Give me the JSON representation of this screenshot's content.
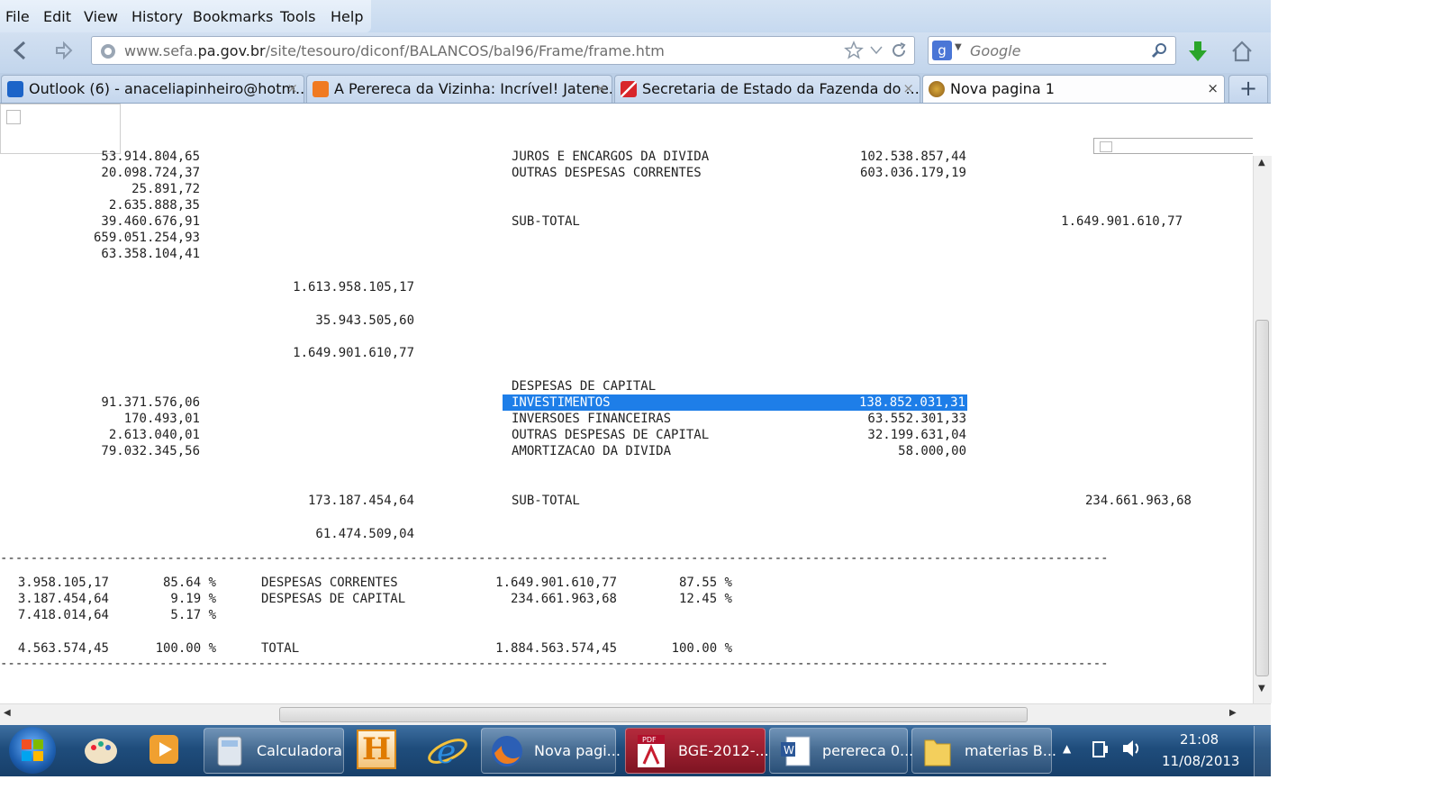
{
  "menu": [
    "File",
    "Edit",
    "View",
    "History",
    "Bookmarks",
    "Tools",
    "Help"
  ],
  "url": {
    "prefix": "www.sefa.",
    "domain": "pa.gov.br",
    "path": "/site/tesouro/diconf/BALANCOS/bal96/Frame/frame.htm"
  },
  "search": {
    "placeholder": "Google"
  },
  "tabs": [
    {
      "label": "Outlook (6) - anaceliapinheiro@hotm...",
      "icon": "outlook-icon"
    },
    {
      "label": "A Perereca da Vizinha: Incrível! Jatene...",
      "icon": "blogger-icon"
    },
    {
      "label": "Secretaria de Estado da Fazenda do ...",
      "icon": "para-flag-icon"
    },
    {
      "label": "Nova pagina 1",
      "icon": "emblem-icon"
    }
  ],
  "report": {
    "left_values": [
      "53.914.804,65",
      "20.098.724,37",
      "25.891,72",
      "2.635.888,35",
      "39.460.676,91",
      "659.051.254,93",
      "63.358.104,41"
    ],
    "subtotal_current": "1.613.958.105,17",
    "extra_current": "35.943.505,60",
    "total_current": "1.649.901.610,77",
    "right_current": [
      {
        "label": "JUROS E ENCARGOS DA DIVIDA",
        "value": "102.538.857,44"
      },
      {
        "label": "OUTRAS DESPESAS CORRENTES",
        "value": "603.036.179,19"
      }
    ],
    "subtotal_label": "SUB-TOTAL",
    "subtotal_right_current": "1.649.901.610,77",
    "capital_heading": "DESPESAS DE CAPITAL",
    "left_capital": [
      "91.371.576,06",
      "170.493,01",
      "2.613.040,01",
      "79.032.345,56"
    ],
    "right_capital": [
      {
        "label": "INVESTIMENTOS",
        "value": "138.852.031,31"
      },
      {
        "label": "INVERSOES FINANCEIRAS",
        "value": "63.552.301,33"
      },
      {
        "label": "OUTRAS DESPESAS DE CAPITAL",
        "value": "32.199.631,04"
      },
      {
        "label": "AMORTIZACAO DA DIVIDA",
        "value": "58.000,00"
      }
    ],
    "subtotal_capital": "173.187.454,64",
    "subtotal_right_capital": "234.661.963,68",
    "extra_capital": "61.474.509,04",
    "summary": [
      {
        "left_value": "3.958.105,17",
        "left_pct": "85.64 %",
        "label": "DESPESAS CORRENTES",
        "value": "1.649.901.610,77",
        "pct": "87.55 %"
      },
      {
        "left_value": "3.187.454,64",
        "left_pct": "9.19 %",
        "label": "DESPESAS DE CAPITAL",
        "value": "234.661.963,68",
        "pct": "12.45 %"
      },
      {
        "left_value": "7.418.014,64",
        "left_pct": "5.17 %",
        "label": "",
        "value": "",
        "pct": ""
      }
    ],
    "total_row": {
      "left_value": "4.563.574,45",
      "left_pct": "100.00 %",
      "label": "TOTAL",
      "value": "1.884.563.574,45",
      "pct": "100.00 %"
    }
  },
  "taskbar": [
    {
      "label": "Calculadora",
      "icon": "calculator-icon"
    },
    {
      "label": "Nova pagi...",
      "icon": "firefox-icon"
    },
    {
      "label": "BGE-2012-...",
      "icon": "pdf-icon"
    },
    {
      "label": "perereca 0...",
      "icon": "word-doc-icon"
    },
    {
      "label": "materias B...",
      "icon": "folder-icon"
    }
  ],
  "clock": {
    "time": "21:08",
    "date": "11/08/2013"
  },
  "colors": {
    "highlight": "#1e7ee8",
    "download_arrow": "#2aa52a"
  }
}
